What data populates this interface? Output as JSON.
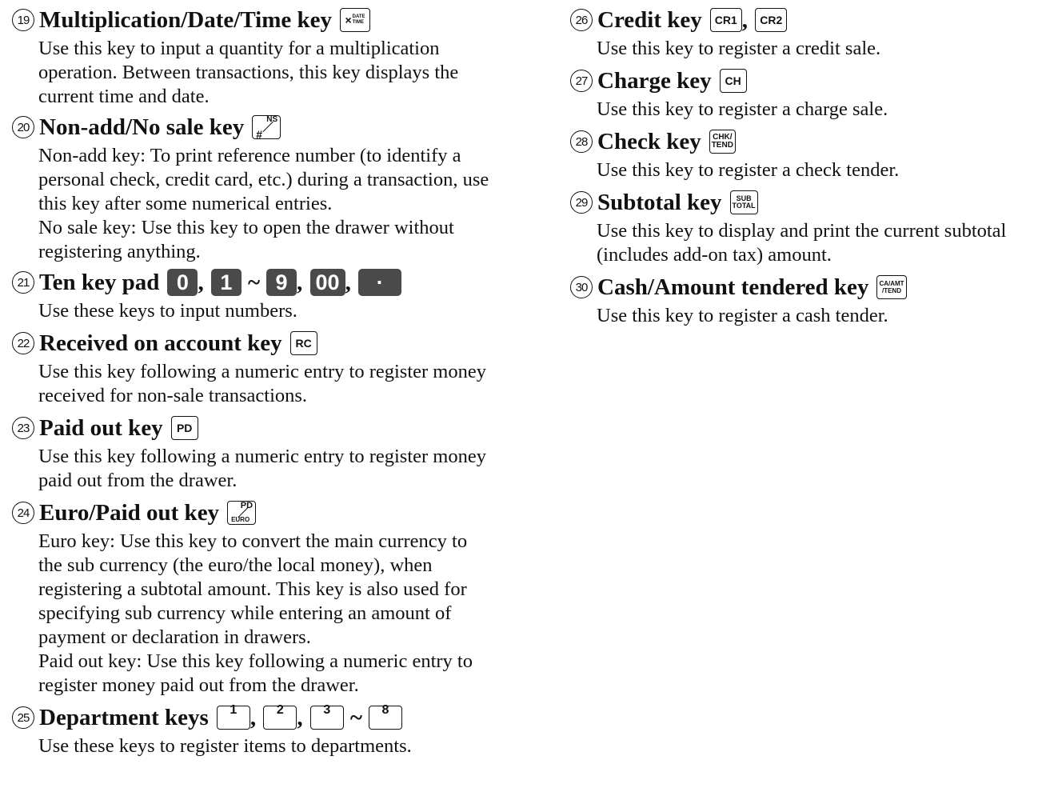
{
  "left": {
    "e19": {
      "num": "19",
      "title": "Multiplication/Date/Time key",
      "key": {
        "top": "×",
        "mid": "DATE",
        "bot": "TIME"
      },
      "lines": [
        "Use this key to input a quantity for a multiplication",
        "operation. Between transactions, this key displays the",
        "current time and date."
      ]
    },
    "e20": {
      "num": "20",
      "title": "Non-add/No sale key",
      "key": {
        "top": "#",
        "bot": "NS"
      },
      "lines": [
        "Non-add key: To print reference number (to identify a",
        "personal check, credit card, etc.) during a transaction, use",
        "this key after some numerical entries.",
        "No sale key: Use this key to open the drawer without",
        "registering anything."
      ]
    },
    "e21": {
      "num": "21",
      "title": "Ten key pad",
      "keys": [
        "0",
        "1",
        "9",
        "00",
        "·"
      ],
      "comma": ",",
      "tilde": "~",
      "lines": [
        "Use these keys to input numbers."
      ]
    },
    "e22": {
      "num": "22",
      "title": "Received on account key",
      "key": "RC",
      "lines": [
        "Use this key following a numeric entry to register money",
        "received for non-sale transactions."
      ]
    },
    "e23": {
      "num": "23",
      "title": "Paid out key",
      "key": "PD",
      "lines": [
        "Use this key following a numeric entry to register money",
        "paid out from the drawer."
      ]
    },
    "e24": {
      "num": "24",
      "title": "Euro/Paid out key",
      "key": {
        "top": "EURO",
        "bot": "PD"
      },
      "lines": [
        "Euro key: Use this key to convert the main currency to",
        "the sub currency (the euro/the local money), when",
        "registering a subtotal amount. This key is also used for",
        "specifying sub currency while entering an amount of",
        "payment or declaration in drawers.",
        "Paid out key: Use this key following a numeric entry to",
        "register money paid out from the drawer."
      ]
    },
    "e25": {
      "num": "25",
      "title": "Department keys",
      "keys": [
        "1",
        "2",
        "3",
        "8"
      ],
      "comma": ",",
      "tilde": "~",
      "lines": [
        "Use these keys to register items to departments."
      ]
    }
  },
  "right": {
    "e26": {
      "num": "26",
      "title": "Credit key",
      "keys": [
        "CR1",
        "CR2"
      ],
      "comma": ",",
      "lines": [
        "Use this key to register a credit sale."
      ]
    },
    "e27": {
      "num": "27",
      "title": "Charge key",
      "key": "CH",
      "lines": [
        "Use this key to register a charge sale."
      ]
    },
    "e28": {
      "num": "28",
      "title": "Check key",
      "key": {
        "top": "CHK/",
        "bot": "TEND"
      },
      "lines": [
        "Use this key to register a check tender."
      ]
    },
    "e29": {
      "num": "29",
      "title": "Subtotal key",
      "key": {
        "top": "SUB",
        "bot": "TOTAL"
      },
      "lines": [
        "Use this key to display and print the current subtotal",
        "(includes add-on tax) amount."
      ]
    },
    "e30": {
      "num": "30",
      "title": "Cash/Amount tendered key",
      "key": {
        "top": "CA/AMT",
        "bot": "/TEND"
      },
      "lines": [
        "Use this key to register a cash tender."
      ]
    }
  }
}
